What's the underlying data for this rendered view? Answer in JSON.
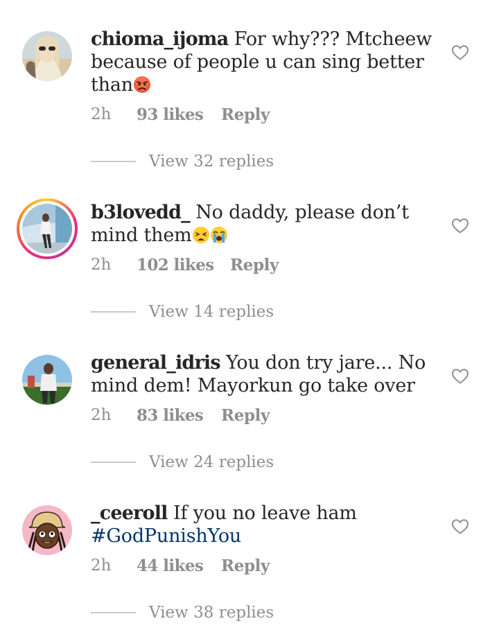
{
  "comments": [
    {
      "username": "chioma_ijoma",
      "text": "For why??? Mtcheew because of people u can sing better than",
      "emoji": "angry-face",
      "time": "2h",
      "likes": "93 likes",
      "reply": "Reply",
      "view_replies": "View 32 replies",
      "avatar_colors": [
        "#d9c7a6",
        "#f2ead9",
        "#7d6b58"
      ]
    },
    {
      "username": "b3lovedd_",
      "text": "No daddy, please don’t mind them",
      "emoji": "weary-face, crying-face",
      "time": "2h",
      "likes": "102 likes",
      "reply": "Reply",
      "view_replies": "View 14 replies",
      "has_story": true,
      "avatar_colors": [
        "#6fa6c8",
        "#d5e4ee",
        "#2c2c2c"
      ]
    },
    {
      "username": "general_idris",
      "text": "You don try jare... No mind dem! Mayorkun go take over",
      "time": "2h",
      "likes": "83 likes",
      "reply": "Reply",
      "view_replies": "View 24 replies",
      "avatar_colors": [
        "#8fc0e6",
        "#f0f0f0",
        "#3a6e2a"
      ]
    },
    {
      "username": "_ceeroll",
      "text": "If you no leave ham",
      "hashtag": "#GodPunishYou",
      "time": "2h",
      "likes": "44 likes",
      "reply": "Reply",
      "view_replies": "View 38 replies",
      "avatar_colors": [
        "#f4b8c6",
        "#6b3f23",
        "#e6c88a"
      ]
    }
  ],
  "icons": {
    "like": "heart-outline-icon"
  },
  "colors": {
    "text": "#262626",
    "muted": "#8e8e8e",
    "hashtag": "#003569"
  }
}
